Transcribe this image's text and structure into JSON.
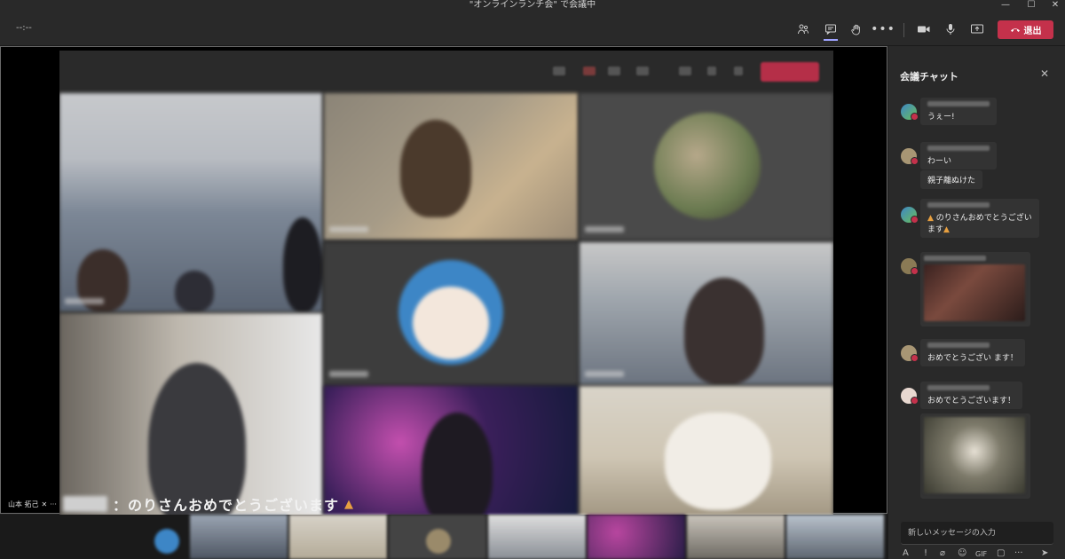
{
  "window": {
    "title": "\"オンラインランチ会\" で会議中",
    "minimize": "—",
    "maximize": "☐",
    "close": "✕"
  },
  "toolbar": {
    "timer": "--:--",
    "leave_label": "退出"
  },
  "caption": {
    "text": "：のりさんおめでとうございます",
    "speaker_name": "山本 拓己"
  },
  "chat": {
    "title": "会議チャット",
    "messages": [
      {
        "text": "うぇー!"
      },
      {
        "text": "わーい"
      },
      {
        "text": "親子離ぬけた"
      },
      {
        "text": "のりさんおめでとうござい",
        "text2": "ます"
      },
      {
        "text": "おめでとうござい ます！"
      },
      {
        "text": "おめでとうございます！"
      }
    ],
    "compose_placeholder": "新しいメッセージの入力"
  },
  "colors": {
    "leave": "#c4314b",
    "accent": "#9ea2ff",
    "panel": "#292929"
  }
}
